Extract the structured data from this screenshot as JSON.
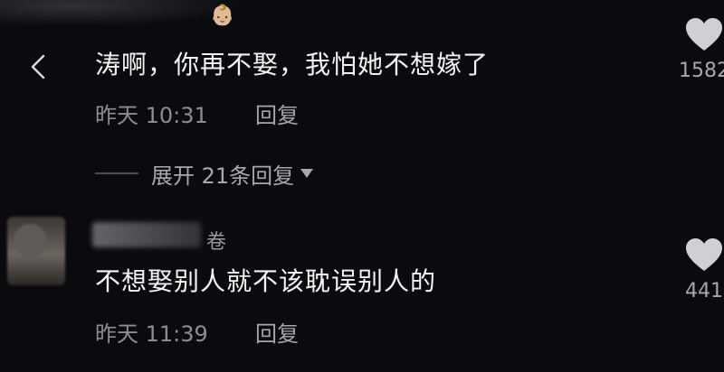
{
  "top": {
    "avatar_emoji": "👶🏼"
  },
  "nav": {
    "back_icon": "chevron-left-icon"
  },
  "comments": [
    {
      "text": "涛啊，你再不娶，我怕她不想嫁了",
      "time": "昨天 10:31",
      "reply_label": "回复",
      "likes": "1582",
      "expand": {
        "label": "展开 21条回复"
      }
    },
    {
      "author_visible": "卷",
      "text": "不想娶别人就不该耽误别人的",
      "time": "昨天 11:39",
      "reply_label": "回复",
      "likes": "441"
    }
  ],
  "colors": {
    "background": "#0b0b0f",
    "text": "#f4f4f4",
    "meta": "#8d8d93",
    "icon": "#cfcfd4"
  }
}
